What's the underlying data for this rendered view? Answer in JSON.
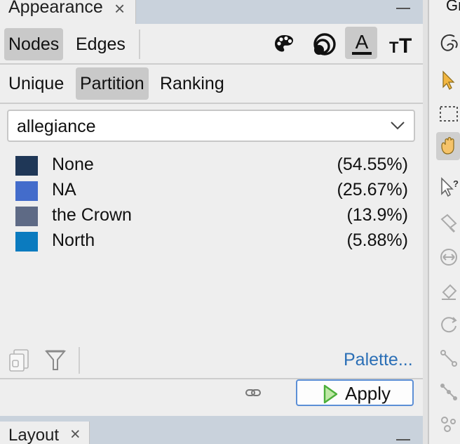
{
  "appearance_panel": {
    "title": "Appearance",
    "close_glyph": "×",
    "target_tabs": [
      {
        "label": "Nodes",
        "active": true
      },
      {
        "label": "Edges",
        "active": false
      }
    ],
    "attribute_buttons": [
      {
        "icon": "palette-icon",
        "active": false
      },
      {
        "icon": "size-rings-icon",
        "active": false
      },
      {
        "icon": "label-color-icon",
        "active": true
      },
      {
        "icon": "label-size-icon",
        "active": false
      }
    ],
    "mode_tabs": [
      {
        "label": "Unique",
        "active": false
      },
      {
        "label": "Partition",
        "active": true
      },
      {
        "label": "Ranking",
        "active": false
      }
    ],
    "attribute_dropdown": {
      "value": "allegiance"
    },
    "partitions": [
      {
        "label": "None",
        "percent": "(54.55%)",
        "color": "#1f3757"
      },
      {
        "label": "NA",
        "percent": "(25.67%)",
        "color": "#436ccb"
      },
      {
        "label": "the Crown",
        "percent": "(13.9%)",
        "color": "#5e6a85"
      },
      {
        "label": "North",
        "percent": "(5.88%)",
        "color": "#0b7bbf"
      }
    ],
    "palette_link": "Palette...",
    "apply_button": "Apply"
  },
  "right_toolbar": {
    "title": "Gr"
  },
  "layout_panel": {
    "title": "Layout",
    "close_glyph": "×"
  },
  "colors": {
    "tab_strip": "#c9d2dc",
    "active_segment": "#c9c9c9",
    "link": "#2b6fb6",
    "apply_border": "#5c8fd6",
    "apply_icon": "#4caf3a"
  }
}
